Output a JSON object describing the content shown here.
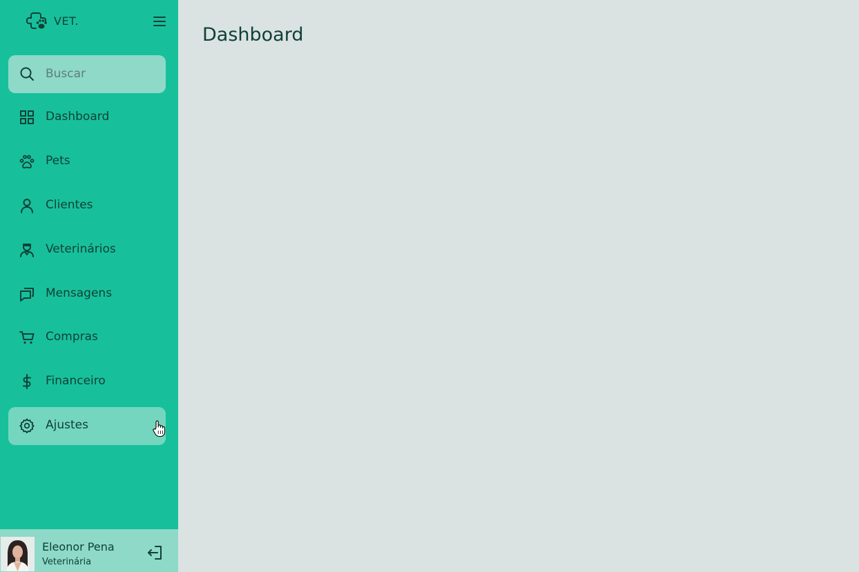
{
  "brand": {
    "name": "VET.",
    "icon": "paw-cross-logo-icon"
  },
  "search": {
    "placeholder": "Buscar",
    "value": ""
  },
  "nav": {
    "items": [
      {
        "label": "Dashboard",
        "icon": "grid-icon"
      },
      {
        "label": "Pets",
        "icon": "paw-icon"
      },
      {
        "label": "Clientes",
        "icon": "user-icon"
      },
      {
        "label": "Veterinários",
        "icon": "doctor-icon"
      },
      {
        "label": "Mensagens",
        "icon": "chat-icon"
      },
      {
        "label": "Compras",
        "icon": "cart-icon"
      },
      {
        "label": "Financeiro",
        "icon": "dollar-icon"
      },
      {
        "label": "Ajustes",
        "icon": "gear-icon",
        "active": true
      }
    ]
  },
  "user": {
    "name": "Eleonor Pena",
    "role": "Veterinária"
  },
  "main": {
    "title": "Dashboard"
  },
  "colors": {
    "sidebar": "#17c09b",
    "sidebar_highlight": "#8ed9c8",
    "active_item": "#75d6bf",
    "main_background": "#dae3e1",
    "text": "#0f4038"
  }
}
